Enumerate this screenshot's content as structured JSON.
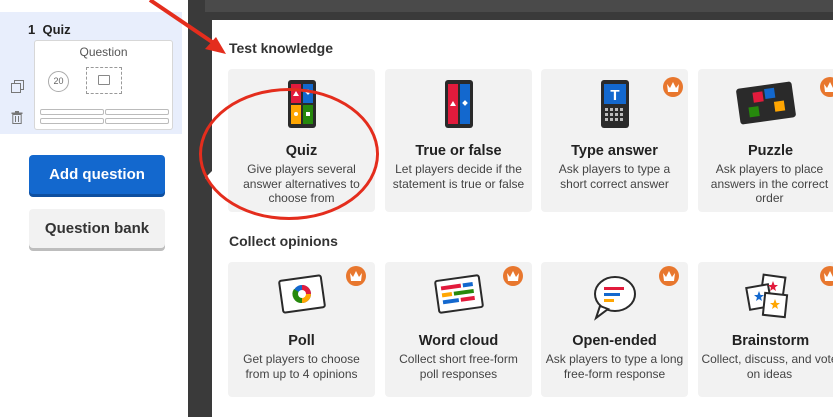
{
  "sidebar": {
    "slide_number": "1",
    "slide_type": "Quiz",
    "thumbnail": {
      "question_placeholder": "Question",
      "timer": "20"
    },
    "add_question_label": "Add question",
    "question_bank_label": "Question bank",
    "icons": {
      "duplicate": "duplicate-icon",
      "delete": "trash-icon"
    }
  },
  "modal": {
    "sections": [
      {
        "title": "Test knowledge",
        "cards": [
          {
            "title": "Quiz",
            "description": "Give players several answer alternatives to choose from",
            "icon": "quiz-icon",
            "premium": false
          },
          {
            "title": "True or false",
            "description": "Let players decide if the statement is true or false",
            "icon": "true-false-icon",
            "premium": false
          },
          {
            "title": "Type answer",
            "description": "Ask players to type a short correct answer",
            "icon": "type-answer-icon",
            "premium": true
          },
          {
            "title": "Puzzle",
            "description": "Ask players to place answers in the correct order",
            "icon": "puzzle-icon",
            "premium": true
          }
        ]
      },
      {
        "title": "Collect opinions",
        "cards": [
          {
            "title": "Poll",
            "description": "Get players to choose from up to 4 opinions",
            "icon": "poll-icon",
            "premium": true
          },
          {
            "title": "Word cloud",
            "description": "Collect short free-form poll responses",
            "icon": "word-cloud-icon",
            "premium": true
          },
          {
            "title": "Open-ended",
            "description": "Ask players to type a long free-form response",
            "icon": "open-ended-icon",
            "premium": true
          },
          {
            "title": "Brainstorm",
            "description": "Collect, discuss, and vote on ideas",
            "icon": "brainstorm-icon",
            "premium": true
          }
        ]
      }
    ]
  },
  "colors": {
    "primary_blue": "#1368ce",
    "premium_orange": "#e8772e",
    "annotation_red": "#e42d1d",
    "kahoot_red": "#e21b3c",
    "kahoot_blue": "#1368ce",
    "kahoot_yellow": "#ffa602",
    "kahoot_green": "#26890c"
  }
}
